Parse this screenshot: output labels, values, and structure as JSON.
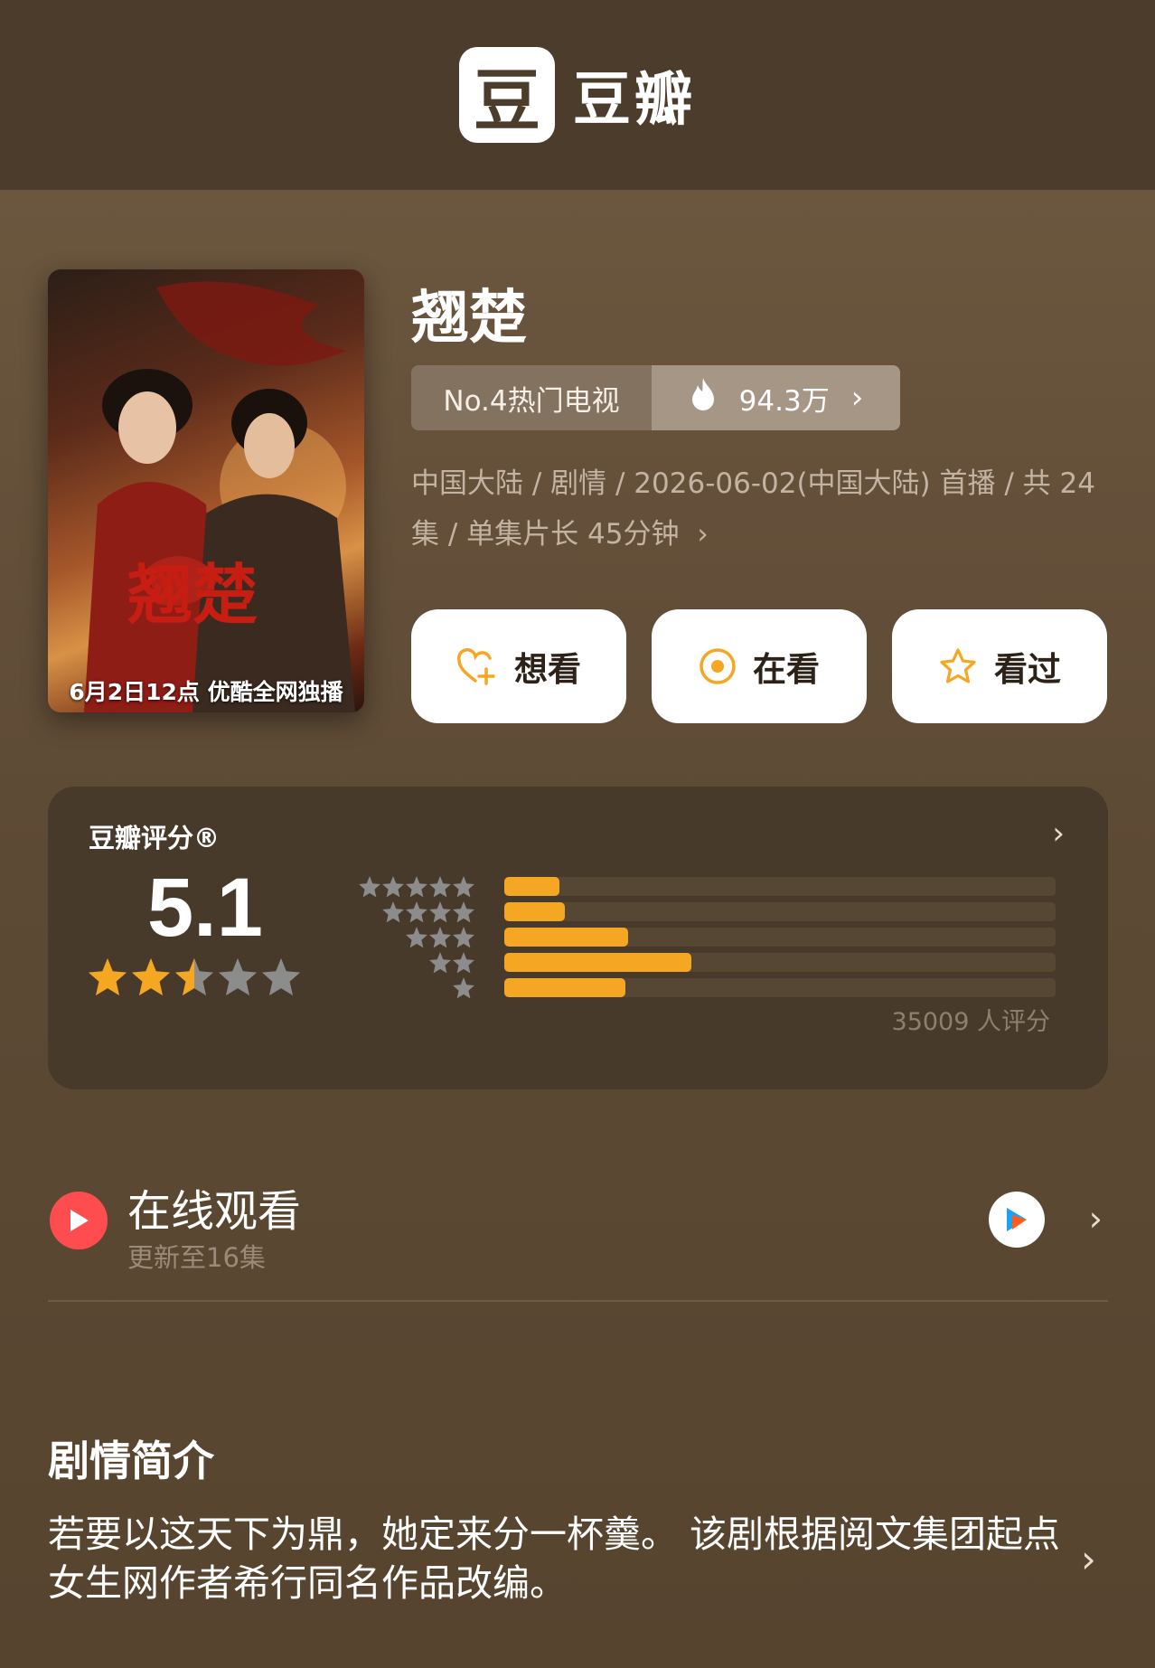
{
  "header": {
    "logo_glyph": "豆",
    "app_name": "豆瓣"
  },
  "show": {
    "title": "翘楚",
    "poster_caption": "6月2日12点 优酷全网独播",
    "rank_label": "No.4热门电视",
    "heat_value": "94.3万",
    "meta": "中国大陆 / 剧情 / 2026-06-02(中国大陆) 首播 / 共 24 集 / 单集片长 45分钟"
  },
  "actions": {
    "want_label": "想看",
    "watching_label": "在看",
    "watched_label": "看过"
  },
  "rating": {
    "label": "豆瓣评分®",
    "score": "5.1",
    "score_value": 5.1,
    "score_stars_out_of_5": 2.5,
    "distribution": [
      {
        "stars": 5,
        "fraction": 0.1
      },
      {
        "stars": 4,
        "fraction": 0.11
      },
      {
        "stars": 3,
        "fraction": 0.225
      },
      {
        "stars": 2,
        "fraction": 0.34
      },
      {
        "stars": 1,
        "fraction": 0.22
      }
    ],
    "count_text": "35009 人评分"
  },
  "watch": {
    "title": "在线观看",
    "subtitle": "更新至16集",
    "play_icon": "play-icon",
    "platform_icon": "youku-icon"
  },
  "synopsis": {
    "title": "剧情简介",
    "text": "若要以这天下为鼎，她定来分一杯羹。 该剧根据阅文集团起点女生网作者希行同名作品改编。"
  },
  "colors": {
    "header_bg": "#4b3c2b",
    "page_bg": "#5d4b36",
    "accent_orange": "#f5a623",
    "star_gray": "#8c8c8c",
    "play_red": "#ff4d4f"
  }
}
